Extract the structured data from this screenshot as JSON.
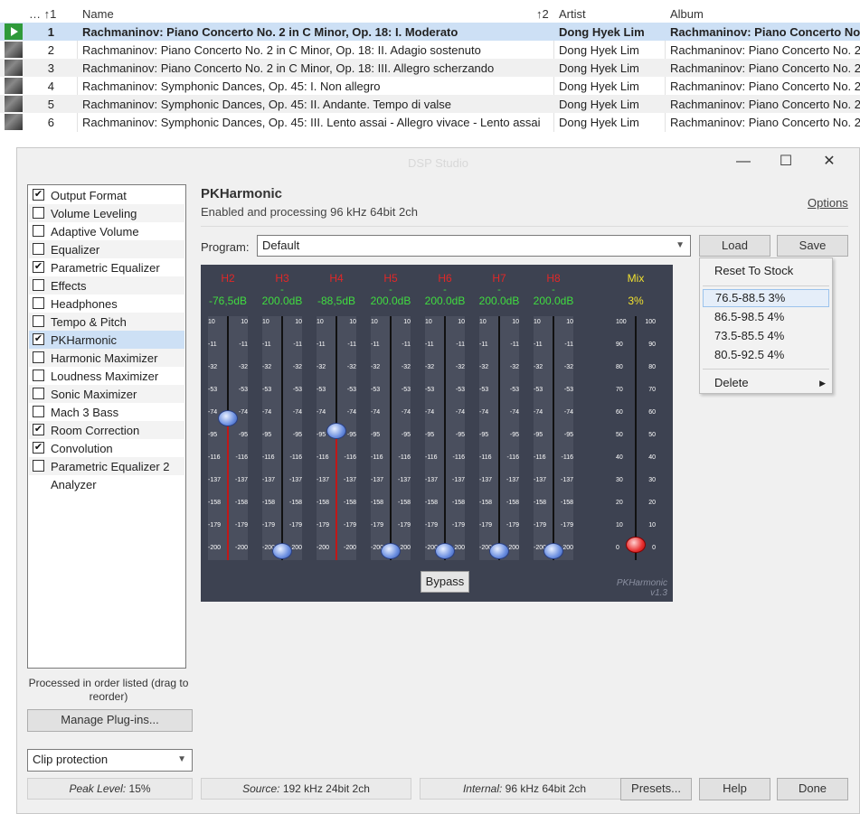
{
  "playlist": {
    "headers": {
      "num": "… ↑1",
      "name": "Name",
      "artist_sort": "↑2",
      "artist": "Artist",
      "album": "Album"
    },
    "rows": [
      {
        "num": "1",
        "name": "Rachmaninov: Piano Concerto No. 2 in C Minor, Op. 18: I. Moderato",
        "artist": "Dong Hyek Lim",
        "album": "Rachmaninov: Piano Concerto No. 2"
      },
      {
        "num": "2",
        "name": "Rachmaninov: Piano Concerto No. 2 in C Minor, Op. 18: II. Adagio sostenuto",
        "artist": "Dong Hyek Lim",
        "album": "Rachmaninov: Piano Concerto No. 2"
      },
      {
        "num": "3",
        "name": "Rachmaninov: Piano Concerto No. 2 in C Minor, Op. 18: III. Allegro scherzando",
        "artist": "Dong Hyek Lim",
        "album": "Rachmaninov: Piano Concerto No. 2"
      },
      {
        "num": "4",
        "name": "Rachmaninov: Symphonic Dances, Op. 45: I. Non allegro",
        "artist": "Dong Hyek Lim",
        "album": "Rachmaninov: Piano Concerto No. 2"
      },
      {
        "num": "5",
        "name": "Rachmaninov: Symphonic Dances, Op. 45: II. Andante. Tempo di valse",
        "artist": "Dong Hyek Lim",
        "album": "Rachmaninov: Piano Concerto No. 2"
      },
      {
        "num": "6",
        "name": "Rachmaninov: Symphonic Dances, Op. 45: III. Lento assai - Allegro vivace - Lento assai",
        "artist": "Dong Hyek Lim",
        "album": "Rachmaninov: Piano Concerto No. 2"
      }
    ]
  },
  "window": {
    "title": "DSP Studio",
    "minimize": "—",
    "maximize": "☐",
    "close": "✕"
  },
  "plugins": [
    {
      "label": "Output Format",
      "checked": true
    },
    {
      "label": "Volume Leveling",
      "checked": false
    },
    {
      "label": "Adaptive Volume",
      "checked": false
    },
    {
      "label": "Equalizer",
      "checked": false
    },
    {
      "label": "Parametric Equalizer",
      "checked": true
    },
    {
      "label": "Effects",
      "checked": false
    },
    {
      "label": "Headphones",
      "checked": false
    },
    {
      "label": "Tempo & Pitch",
      "checked": false
    },
    {
      "label": "PKHarmonic",
      "checked": true,
      "selected": true
    },
    {
      "label": "Harmonic Maximizer",
      "checked": false
    },
    {
      "label": "Loudness Maximizer",
      "checked": false
    },
    {
      "label": "Sonic Maximizer",
      "checked": false
    },
    {
      "label": "Mach 3 Bass",
      "checked": false
    },
    {
      "label": "Room Correction",
      "checked": true
    },
    {
      "label": "Convolution",
      "checked": true
    },
    {
      "label": "Parametric Equalizer 2",
      "checked": false
    },
    {
      "label": "Analyzer",
      "checked": null
    }
  ],
  "left": {
    "note": "Processed in order listed (drag to reorder)",
    "manage": "Manage Plug-ins...",
    "clip": "Clip protection"
  },
  "plugin": {
    "title": "PKHarmonic",
    "status": "Enabled and processing 96 kHz 64bit 2ch",
    "options": "Options",
    "program_label": "Program:",
    "program_value": "Default",
    "load": "Load",
    "save": "Save"
  },
  "menu": {
    "reset": "Reset To Stock",
    "presets": [
      "76.5-88.5 3%",
      "86.5-98.5 4%",
      "73.5-85.5 4%",
      "80.5-92.5 4%"
    ],
    "highlighted": 0,
    "delete": "Delete",
    "submenu_arrow": "▶"
  },
  "harmonic": {
    "channels": [
      {
        "label": "H2",
        "value": "-76,5dB",
        "dash": "",
        "level_db": -76.5,
        "active": true
      },
      {
        "label": "H3",
        "value": "200.0dB",
        "dash": "-",
        "level_db": -200,
        "active": false
      },
      {
        "label": "H4",
        "value": "-88,5dB",
        "dash": "",
        "level_db": -88.5,
        "active": true
      },
      {
        "label": "H5",
        "value": "200.0dB",
        "dash": "-",
        "level_db": -200,
        "active": false
      },
      {
        "label": "H6",
        "value": "200.0dB",
        "dash": "-",
        "level_db": -200,
        "active": false
      },
      {
        "label": "H7",
        "value": "200.0dB",
        "dash": "-",
        "level_db": -200,
        "active": false
      },
      {
        "label": "H8",
        "value": "200.0dB",
        "dash": "-",
        "level_db": -200,
        "active": false
      }
    ],
    "db_ticks": [
      "10",
      "-11",
      "-32",
      "-53",
      "-74",
      "-95",
      "-116",
      "-137",
      "-158",
      "-179",
      "-200"
    ],
    "mix": {
      "label": "Mix",
      "value": "3%",
      "level_pct": 3
    },
    "mix_ticks": [
      "100",
      "90",
      "80",
      "70",
      "60",
      "50",
      "40",
      "30",
      "20",
      "10",
      "0"
    ],
    "bypass": "Bypass",
    "brand": "PKHarmonic",
    "version": "v1.3",
    "colors": {
      "panel": "#3d4251",
      "label_red": "#e02828",
      "value_green": "#40dc40",
      "mix_yellow": "#f0e030"
    }
  },
  "statusbar": {
    "peak_label": "Peak Level:",
    "peak_value": "15%",
    "source_label": "Source:",
    "source_value": "192 kHz 24bit 2ch",
    "internal_label": "Internal:",
    "internal_value": "96 kHz 64bit 2ch",
    "presets": "Presets...",
    "help": "Help",
    "done": "Done"
  }
}
